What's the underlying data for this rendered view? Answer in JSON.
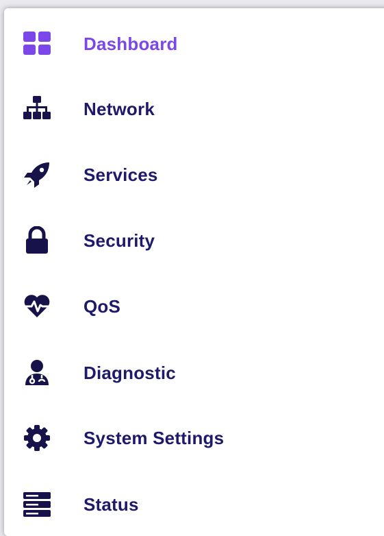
{
  "colors": {
    "active": "#7b47e8",
    "text": "#1d1a6b",
    "icon": "#17124a"
  },
  "menu": {
    "items": [
      {
        "label": "Dashboard",
        "icon": "dashboard-grid-icon",
        "active": true
      },
      {
        "label": "Network",
        "icon": "network-sitemap-icon",
        "active": false
      },
      {
        "label": "Services",
        "icon": "rocket-icon",
        "active": false
      },
      {
        "label": "Security",
        "icon": "lock-icon",
        "active": false
      },
      {
        "label": "QoS",
        "icon": "heartbeat-icon",
        "active": false
      },
      {
        "label": "Diagnostic",
        "icon": "doctor-stethoscope-icon",
        "active": false
      },
      {
        "label": "System Settings",
        "icon": "gear-icon",
        "active": false
      },
      {
        "label": "Status",
        "icon": "server-stack-icon",
        "active": false
      }
    ]
  }
}
